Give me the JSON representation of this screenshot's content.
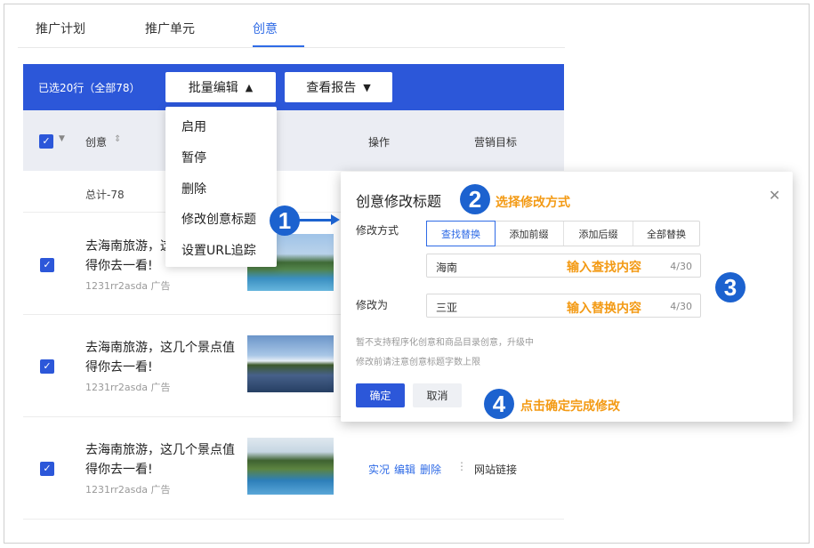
{
  "tabs": [
    {
      "label": "推广计划",
      "active": false
    },
    {
      "label": "推广单元",
      "active": false
    },
    {
      "label": "创意",
      "active": true
    }
  ],
  "toolbar": {
    "selection_text": "已选20行（全部78）",
    "batch_edit_label": "批量编辑",
    "view_report_label": "查看报告"
  },
  "table": {
    "columns": [
      "创意",
      "操作",
      "营销目标"
    ],
    "total_label": "总计-78",
    "rows": [
      {
        "title": "去海南旅游，这几个景点值得你去一看!",
        "subtitle": "1231rr2asda 广告",
        "links": [],
        "goal": ""
      },
      {
        "title": "去海南旅游，这几个景点值得你去一看!",
        "subtitle": "1231rr2asda 广告",
        "links": [],
        "goal": ""
      },
      {
        "title": "去海南旅游，这几个景点值得你去一看!",
        "subtitle": "1231rr2asda 广告",
        "links": [
          "实况",
          "编辑",
          "删除"
        ],
        "goal": "网站链接"
      }
    ]
  },
  "dropdown_menu": {
    "items": [
      "启用",
      "暂停",
      "删除",
      "修改创意标题",
      "设置URL追踪"
    ]
  },
  "modal": {
    "title": "创意修改标题",
    "mode_label": "修改方式",
    "modes": [
      "查找替换",
      "添加前缀",
      "添加后缀",
      "全部替换"
    ],
    "active_mode": "查找替换",
    "find_value": "海南",
    "find_count": "4/30",
    "replace_label": "修改为",
    "replace_value": "三亚",
    "replace_count": "4/30",
    "notes": [
      "暂不支持程序化创意和商品目录创意，升级中",
      "修改前请注意创意标题字数上限"
    ],
    "ok_label": "确定",
    "cancel_label": "取消"
  },
  "callouts": {
    "step1": "1",
    "step2": "2",
    "step3": "3",
    "step4": "4",
    "note2": "选择修改方式",
    "note_find": "输入查找内容",
    "note_replace": "输入替换内容",
    "note4": "点击确定完成修改"
  },
  "colors": {
    "primary": "#2c57d9",
    "accent_orange": "#f39a14",
    "marker_blue": "#1c62cf"
  }
}
